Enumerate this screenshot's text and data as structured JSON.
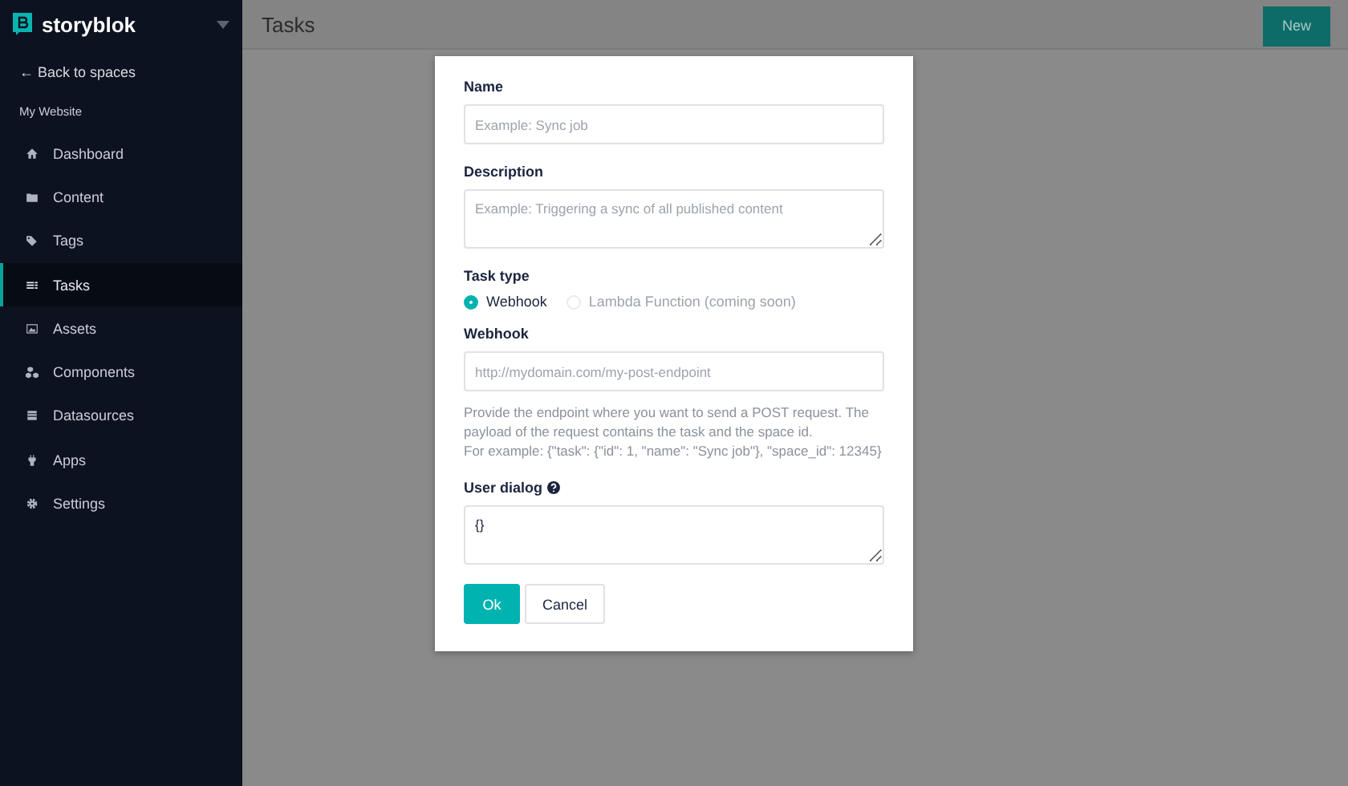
{
  "sidebar": {
    "brand": "storyblok",
    "back_link": "← Back to spaces",
    "space_name": "My Website",
    "items": [
      {
        "label": "Dashboard",
        "selected": false
      },
      {
        "label": "Content",
        "selected": false
      },
      {
        "label": "Tags",
        "selected": false
      },
      {
        "label": "Tasks",
        "selected": true
      },
      {
        "label": "Assets",
        "selected": false
      },
      {
        "label": "Components",
        "selected": false
      },
      {
        "label": "Datasources",
        "selected": false
      },
      {
        "label": "Apps",
        "selected": false
      },
      {
        "label": "Settings",
        "selected": false
      }
    ]
  },
  "header": {
    "title": "Tasks",
    "new_button": "New"
  },
  "modal": {
    "name_label": "Name",
    "name_placeholder": "Example: Sync job",
    "description_label": "Description",
    "description_placeholder": "Example: Triggering a sync of all published content",
    "task_type_label": "Task type",
    "task_types": [
      {
        "label": "Webhook",
        "selected": true,
        "disabled": false
      },
      {
        "label": "Lambda Function (coming soon)",
        "selected": false,
        "disabled": true
      }
    ],
    "webhook_label": "Webhook",
    "webhook_placeholder": "http://mydomain.com/my-post-endpoint",
    "webhook_help": "Provide the endpoint where you want to send a POST request. The payload of the request contains the task and the space id.",
    "webhook_example": "For example: {\"task\": {\"id\": 1, \"name\": \"Sync job\"}, \"space_id\": 12345}",
    "user_dialog_label": "User dialog",
    "user_dialog_value": "{}",
    "ok_button": "Ok",
    "cancel_button": "Cancel"
  }
}
